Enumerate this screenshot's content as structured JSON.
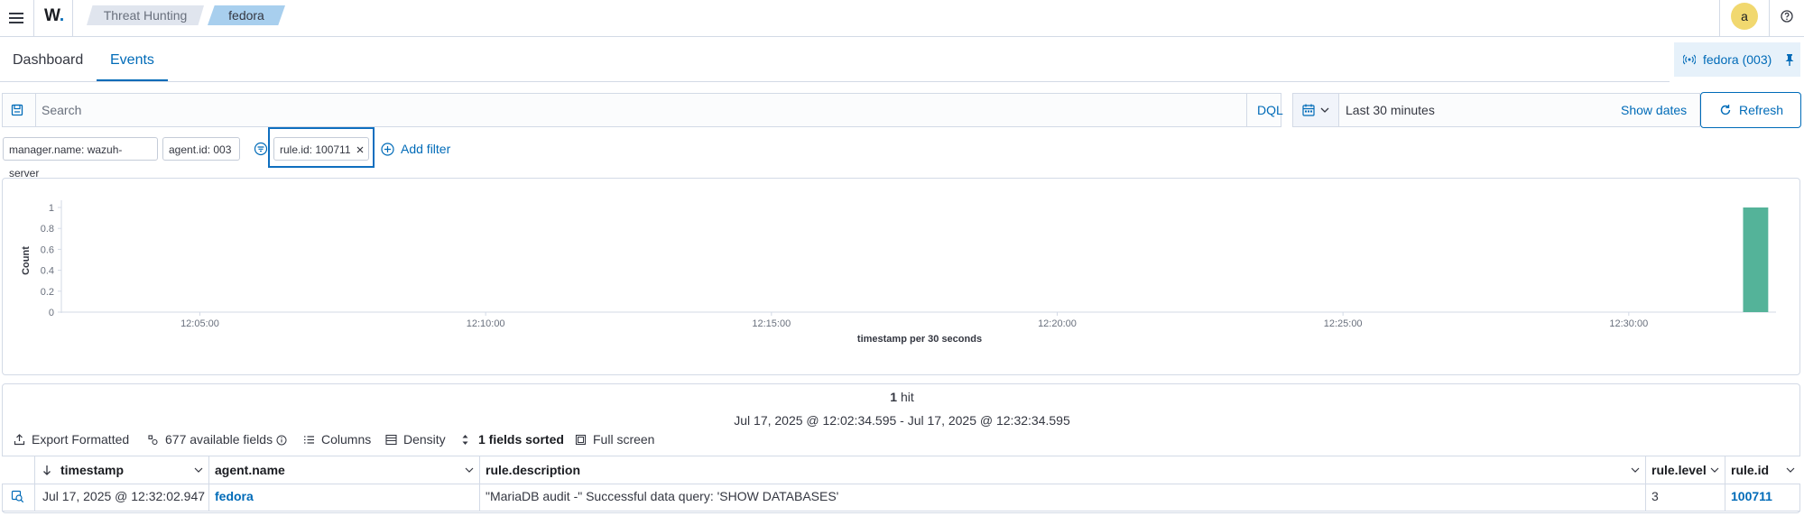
{
  "header": {
    "logo_text": "W",
    "breadcrumbs": [
      {
        "label": "Threat Hunting"
      },
      {
        "label": "fedora"
      }
    ],
    "avatar_initial": "a"
  },
  "tabs": [
    {
      "label": "Dashboard",
      "active": false
    },
    {
      "label": "Events",
      "active": true
    }
  ],
  "agent_pill": {
    "label": "fedora (003)"
  },
  "search": {
    "placeholder": "Search",
    "language": "DQL"
  },
  "time": {
    "range": "Last 30 minutes",
    "show_dates": "Show dates",
    "refresh": "Refresh"
  },
  "filters": [
    {
      "label": "manager.name: wazuh-server"
    },
    {
      "label": "agent.id: 003"
    },
    {
      "label": "rule.id: 100711",
      "highlighted": true
    }
  ],
  "add_filter": "Add filter",
  "chart_data": {
    "type": "bar",
    "xlabel": "timestamp per 30 seconds",
    "ylabel": "Count",
    "y_ticks": [
      "0",
      "0.2",
      "0.4",
      "0.6",
      "0.8",
      "1"
    ],
    "ylim": [
      0,
      1
    ],
    "x_ticks": [
      "12:05:00",
      "12:10:00",
      "12:15:00",
      "12:20:00",
      "12:25:00",
      "12:30:00"
    ],
    "xlim": [
      "12:02:34.595",
      "12:32:34.595"
    ],
    "bars": [
      {
        "x": "12:32:00",
        "value": 1
      }
    ],
    "color": "#54b399"
  },
  "results": {
    "hits_count": "1",
    "hits_label": "hit",
    "range_text": "Jul 17, 2025 @ 12:02:34.595 - Jul 17, 2025 @ 12:32:34.595",
    "toolbar": {
      "export": "Export Formatted",
      "fields": "677 available fields",
      "columns": "Columns",
      "density": "Density",
      "sorted": "1 fields sorted",
      "fullscreen": "Full screen"
    },
    "columns": [
      "timestamp",
      "agent.name",
      "rule.description",
      "rule.level",
      "rule.id"
    ],
    "rows": [
      {
        "timestamp": "Jul 17, 2025 @ 12:32:02.947",
        "agent_name": "fedora",
        "rule_description": "\"MariaDB audit -\" Successful data query: 'SHOW DATABASES'",
        "rule_level": "3",
        "rule_id": "100711"
      }
    ]
  },
  "colors": {
    "accent": "#006bb8",
    "bar": "#54b399",
    "highlight_border": "#0f6fbf"
  }
}
